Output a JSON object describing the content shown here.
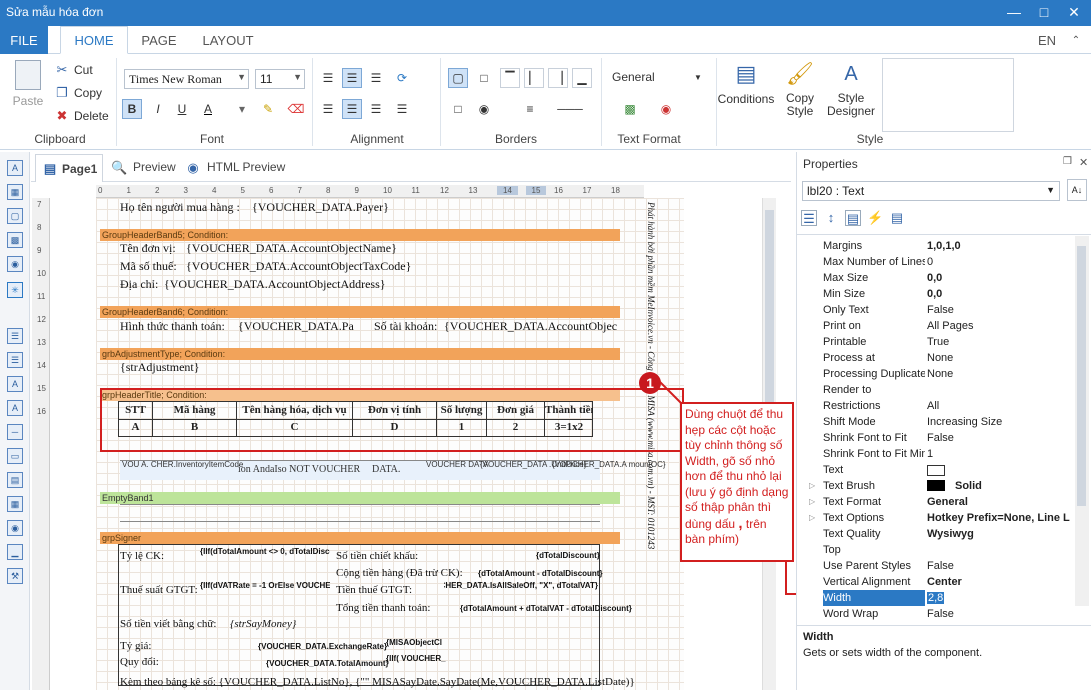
{
  "window": {
    "title": "Sửa mẫu hóa đơn"
  },
  "ribbon_tabs": {
    "file": "FILE",
    "home": "HOME",
    "page": "PAGE",
    "layout": "LAYOUT",
    "language": "EN"
  },
  "clipboard": {
    "paste": "Paste",
    "cut": "Cut",
    "copy": "Copy",
    "delete": "Delete",
    "label": "Clipboard"
  },
  "font": {
    "family": "Times New Roman",
    "size": "11",
    "label": "Font"
  },
  "alignment": {
    "label": "Alignment"
  },
  "borders": {
    "label": "Borders"
  },
  "text_format": {
    "value": "General",
    "label": "Text Format"
  },
  "style": {
    "conditions": "Conditions",
    "copy_style": "Copy Style",
    "style_designer": "Style Designer",
    "label": "Style"
  },
  "doc_tabs": {
    "page1": "Page1",
    "preview": "Preview",
    "html_preview": "HTML Preview"
  },
  "ruler": {
    "h": [
      "0",
      "1",
      "2",
      "3",
      "4",
      "5",
      "6",
      "7",
      "8",
      "9",
      "10",
      "11",
      "12",
      "13",
      "14",
      "15",
      "16",
      "17",
      "18"
    ],
    "v": [
      "7",
      "8",
      "9",
      "10",
      "11",
      "12",
      "13",
      "14",
      "15",
      "16"
    ]
  },
  "report": {
    "buyer_label": "Họ tên người mua hàng :",
    "buyer_value": "{VOUCHER_DATA.Payer}",
    "band5": "GroupHeaderBand5; Condition:",
    "unit_label": "Tên đơn vị:",
    "unit_value": "{VOUCHER_DATA.AccountObjectName}",
    "tax_label": "Mã số thuế:",
    "tax_value": "{VOUCHER_DATA.AccountObjectTaxCode}",
    "addr_label": "Địa chỉ:",
    "addr_value": "{VOUCHER_DATA.AccountObjectAddress}",
    "band6": "GroupHeaderBand6; Condition:",
    "pay_label": "Hình thức thanh toán:",
    "pay_value": "{VOUCHER_DATA.Pa",
    "acct_label": "Số tài khoản:",
    "acct_value": "{VOUCHER_DATA.AccountObjec",
    "adj_band": "grbAdjustmentType; Condition:",
    "adj_value": "{strAdjustment}",
    "hdr_band": "grpHeaderTitle; Condition:",
    "cols": [
      "STT",
      "Mã hàng",
      "Tên hàng hóa, dịch vụ",
      "Đơn vị tính",
      "Số lượng",
      "Đơn giá",
      "Thành tiền"
    ],
    "col_ids": [
      "A",
      "B",
      "C",
      "D",
      "1",
      "2",
      "3=1x2"
    ],
    "data_row": [
      "VOU A. CHER.InventoryItemCode",
      "ion AndaIso NOT VOUCHER",
      "DATA.",
      "VOUCHER DATA",
      "{VOUCHER_DATA .UnitPrice}",
      "{VOUCHER_DATA.A mountOC}"
    ],
    "empty_band": "EmptyBand1",
    "signer_band": "grpSigner",
    "ck_label": "Tỷ lệ CK:",
    "ck_expr": "{IIf(dTotalAmount <> 0, dTotalDiscount/dTotalAmount *",
    "ck_amount_label": "Số tiền chiết khấu:",
    "ck_amount": "{dTotalDiscount}",
    "total_label": "Cộng tiền hàng (Đã trừ CK):",
    "total_amount": "{dTotalAmount - dTotalDiscount}",
    "vat_rate_label": "Thuế suất GTGT:",
    "vat_rate_expr": "{IIf(dVATRate = -1 OrElse VOUCHER_DATA.IsAllSaleOff, \"X\"",
    "vat_label": "Tiền thuế GTGT:",
    "vat_expr": "{IIf(dVATRate = -1 OrElse VOUCHER_DATA.IsAllSaleOff, \"X\", dTotalVAT}",
    "grand_label": "Tổng tiền thanh toán:",
    "grand_expr": "{dTotalAmount + dTotalVAT - dTotalDiscount}",
    "words_label": "Số tiền viết bằng chữ:",
    "words_value": "{strSayMoney}",
    "rate_label": "Tỷ giá:",
    "rate_value": "{VOUCHER_DATA.ExchangeRate}",
    "rate_ms": "{MISAObjectCl",
    "conv_label": "Quy đổi:",
    "conv_value": "{VOUCHER_DATA.TotalAmount}",
    "conv_iif": "{IIf( VOUCHER_",
    "attach": "Kèm theo bảng kê số:  {VOUCHER_DATA.ListNo}, {\"\" MISASayDate.SayDate(Me,VOUCHER_DATA.ListDate)}",
    "side_text": "Phát hành bởi phần mềm MeInvoice.vn - Công ty CP MISA (www.misa.com.vn) - MST: 0101243"
  },
  "callout": {
    "number": "1",
    "text": "Dùng chuột để thu hẹp các cột hoặc tùy chỉnh thông số Width, gõ số nhỏ hơn để thu nhỏ lại (lưu ý gõ định dạng số thập phân thì dùng dấu",
    "comma": ",",
    "tail": "trên bàn phím)"
  },
  "properties": {
    "title": "Properties",
    "object": "lbl20 : Text",
    "rows": [
      {
        "name": "Margins",
        "value": "1,0,1,0",
        "bold": true
      },
      {
        "name": "Max Number of Lines",
        "value": "0"
      },
      {
        "name": "Max Size",
        "value": "0,0",
        "bold": true
      },
      {
        "name": "Min Size",
        "value": "0,0",
        "bold": true
      },
      {
        "name": "Only Text",
        "value": "False"
      },
      {
        "name": "Print on",
        "value": "All Pages"
      },
      {
        "name": "Printable",
        "value": "True"
      },
      {
        "name": "Process at",
        "value": "None"
      },
      {
        "name": "Processing Duplicates",
        "value": "None"
      },
      {
        "name": "Render to",
        "value": ""
      },
      {
        "name": "Restrictions",
        "value": "All"
      },
      {
        "name": "Shift Mode",
        "value": "Increasing Size"
      },
      {
        "name": "Shrink Font to Fit",
        "value": "False"
      },
      {
        "name": "Shrink Font to Fit Minimum",
        "value": "1"
      },
      {
        "name": "Text",
        "value": ""
      },
      {
        "name": "Text Brush",
        "value": "Solid",
        "bold": true
      },
      {
        "name": "Text Format",
        "value": "General",
        "bold": true
      },
      {
        "name": "Text Options",
        "value": "Hotkey Prefix=None, Line L",
        "bold": true
      },
      {
        "name": "Text Quality",
        "value": "Wysiwyg",
        "bold": true
      },
      {
        "name": "Top",
        "value": ""
      },
      {
        "name": "Use Parent Styles",
        "value": "False"
      },
      {
        "name": "Vertical Alignment",
        "value": "Center",
        "bold": true
      },
      {
        "name": "Width",
        "value": "2,8",
        "selected": true
      },
      {
        "name": "Word Wrap",
        "value": "False"
      }
    ],
    "desc_title": "Width",
    "desc_text": "Gets or sets width of the component."
  }
}
